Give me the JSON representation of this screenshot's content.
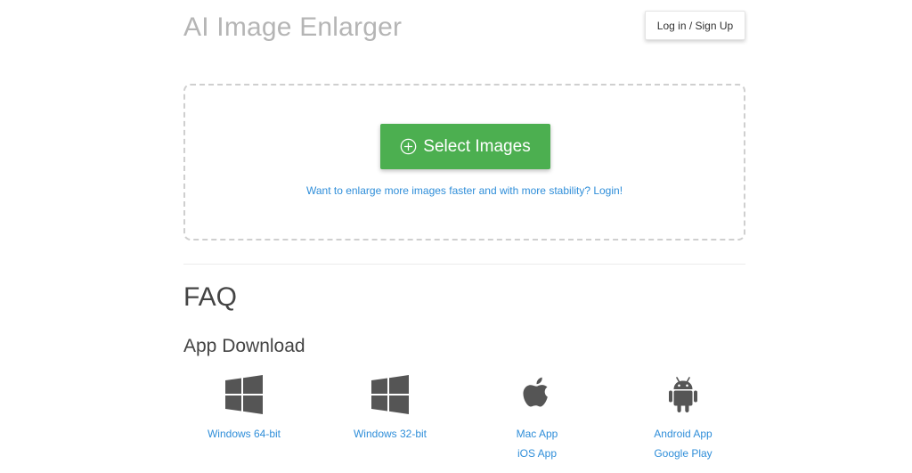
{
  "header": {
    "title": "AI Image Enlarger",
    "login_label": "Log in / Sign Up"
  },
  "upload": {
    "select_label": "Select Images",
    "login_hint": "Want to enlarge more images faster and with more stability? Login!"
  },
  "faq": {
    "title": "FAQ"
  },
  "downloads": {
    "title": "App Download",
    "items": [
      {
        "icon": "windows-icon",
        "links": [
          "Windows 64-bit"
        ]
      },
      {
        "icon": "windows-icon",
        "links": [
          "Windows 32-bit"
        ]
      },
      {
        "icon": "apple-icon",
        "links": [
          "Mac App",
          "iOS App"
        ]
      },
      {
        "icon": "android-icon",
        "links": [
          "Android App",
          "Google Play"
        ]
      }
    ]
  },
  "colors": {
    "primary_button": "#4caf50",
    "link": "#2f8ed9",
    "title_muted": "#b5b5b5",
    "icon": "#555555"
  }
}
